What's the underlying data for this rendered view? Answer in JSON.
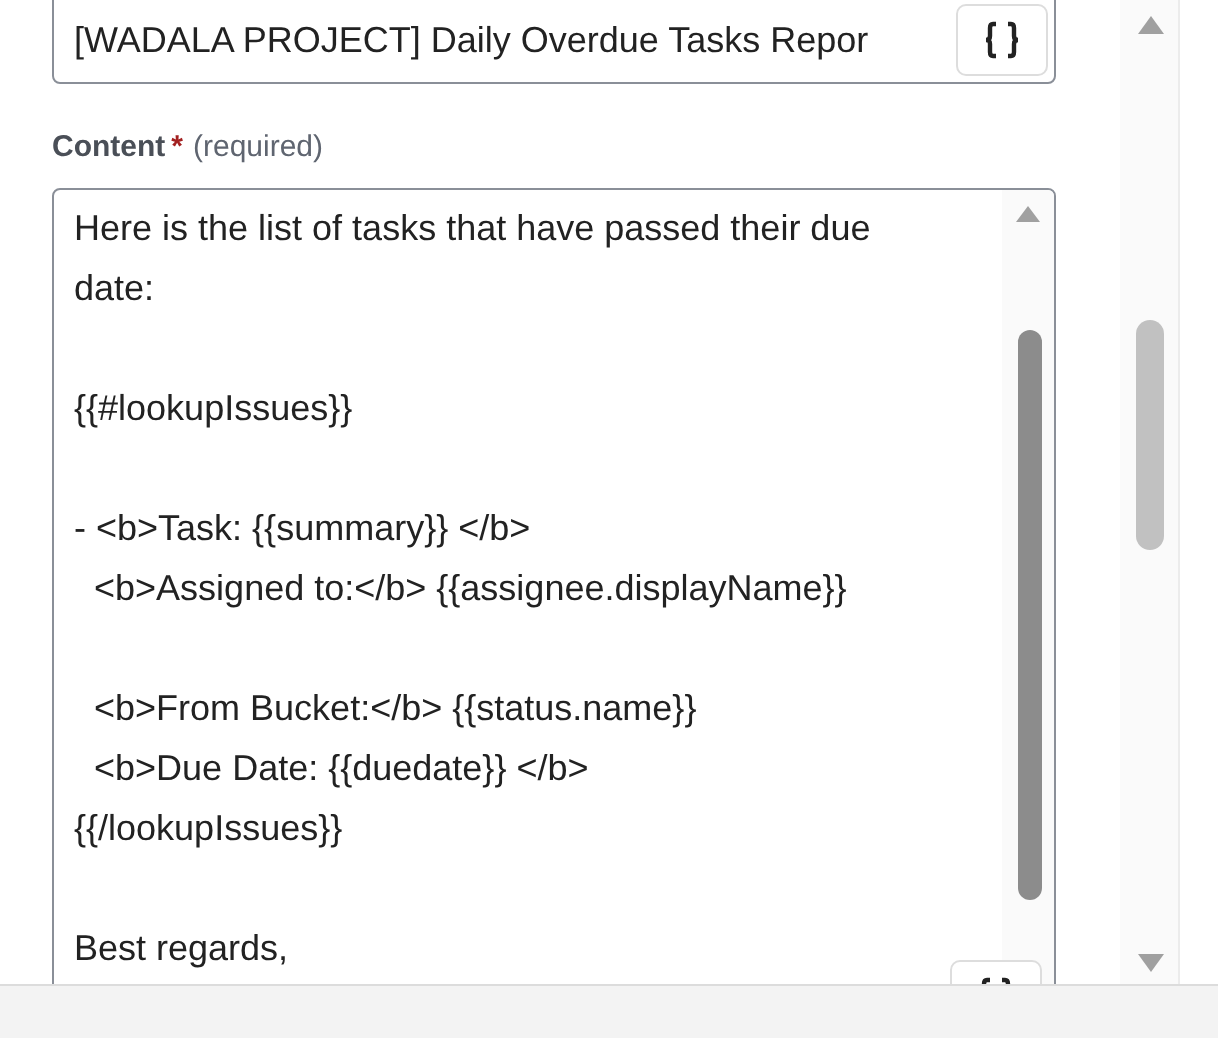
{
  "subject_field": {
    "value": "[WADALA PROJECT] Daily Overdue Tasks Repor"
  },
  "content_field": {
    "label": "Content",
    "required_mark": "*",
    "hint": "(required)",
    "value": "Here is the list of tasks that have passed their due date:\n\n{{#lookupIssues}}\n\n- <b>Task: {{summary}} </b>\n  <b>Assigned to:</b> {{assignee.displayName}}\n\n  <b>From Bucket:</b> {{status.name}}\n  <b>Due Date: {{duedate}} </b>\n{{/lookupIssues}}\n\nBest regards,"
  }
}
